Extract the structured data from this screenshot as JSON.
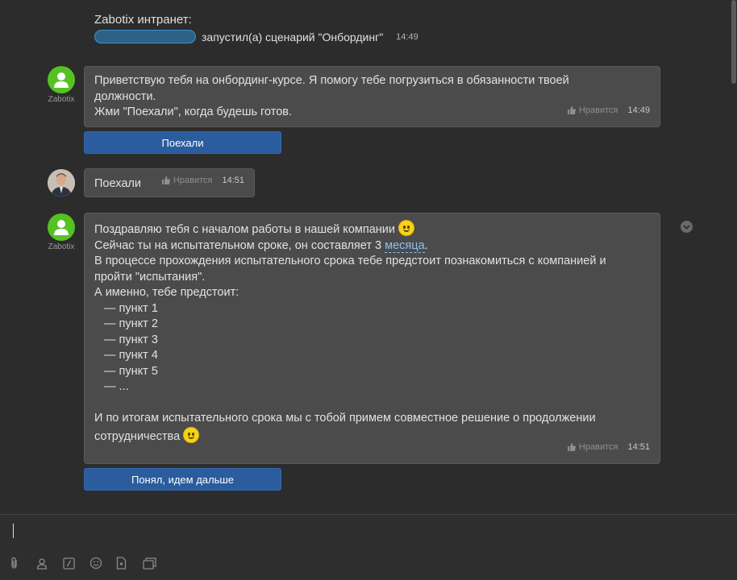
{
  "system": {
    "sender": "Zabotix интранет:",
    "text": "запустил(а) сценарий \"Онбординг\"",
    "time": "14:49"
  },
  "messages": [
    {
      "author": "Zabotix",
      "lines": [
        "Приветствую тебя на онбординг-курсе. Я помогу тебе погрузиться в обязанности твоей",
        "должности.",
        "Жми \"Поехали\", когда будешь готов."
      ],
      "like": "Нравится",
      "time": "14:49",
      "button": "Поехали"
    },
    {
      "text": "Поехали",
      "like": "Нравится",
      "time": "14:51"
    },
    {
      "author": "Zabotix",
      "line1": "Поздравляю тебя с началом работы в нашей компании",
      "line2_pre": "Сейчас ты на испытательном сроке, он составляет 3",
      "line2_link": "месяца",
      "line2_post": ".",
      "line3": "В процессе прохождения испытательного срока тебе предстоит познакомиться с компанией и",
      "line4": "пройти \"испытания\".",
      "line5": "А именно, тебе предстоит:",
      "items": [
        "— пункт 1",
        "— пункт 2",
        "— пункт 3",
        "— пункт 4",
        "— пункт 5",
        "— ..."
      ],
      "line_end1": "И по итогам испытательного срока мы с тобой примем совместное решение о продолжении",
      "line_end2": "сотрудничества",
      "like": "Нравится",
      "time": "14:51",
      "button": "Понял, идем дальше"
    }
  ],
  "composer": {
    "tools": [
      "paperclip-icon",
      "contact-icon",
      "command-icon",
      "smile-icon",
      "file-icon",
      "history-icon"
    ]
  }
}
